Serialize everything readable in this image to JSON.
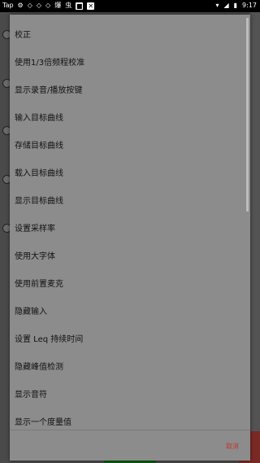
{
  "status_bar": {
    "left_icons": [
      "Tap",
      "⚙",
      "◇",
      "◇",
      "◇",
      "爆",
      "虫",
      "■",
      "✕"
    ],
    "time": "9:17"
  },
  "menu": {
    "items": [
      {
        "label": "校正"
      },
      {
        "label": "使用1/3倍频程校准"
      },
      {
        "label": "显示录音/播放按键"
      },
      {
        "label": "输入目标曲线"
      },
      {
        "label": "存储目标曲线"
      },
      {
        "label": "载入目标曲线"
      },
      {
        "label": "显示目标曲线"
      },
      {
        "label": "设置采样率"
      },
      {
        "label": "使用大字体"
      },
      {
        "label": "使用前置麦克"
      },
      {
        "label": "隐藏输入"
      },
      {
        "label": "设置 Leq 持续时间"
      },
      {
        "label": "隐藏峰值检测"
      },
      {
        "label": "显示音符"
      },
      {
        "label": "显示一个度量值"
      }
    ]
  },
  "dialog": {
    "cancel_label": "取消"
  },
  "colors": {
    "cancel": "#c0392b",
    "dialog_bg": "#8c8c8c"
  }
}
